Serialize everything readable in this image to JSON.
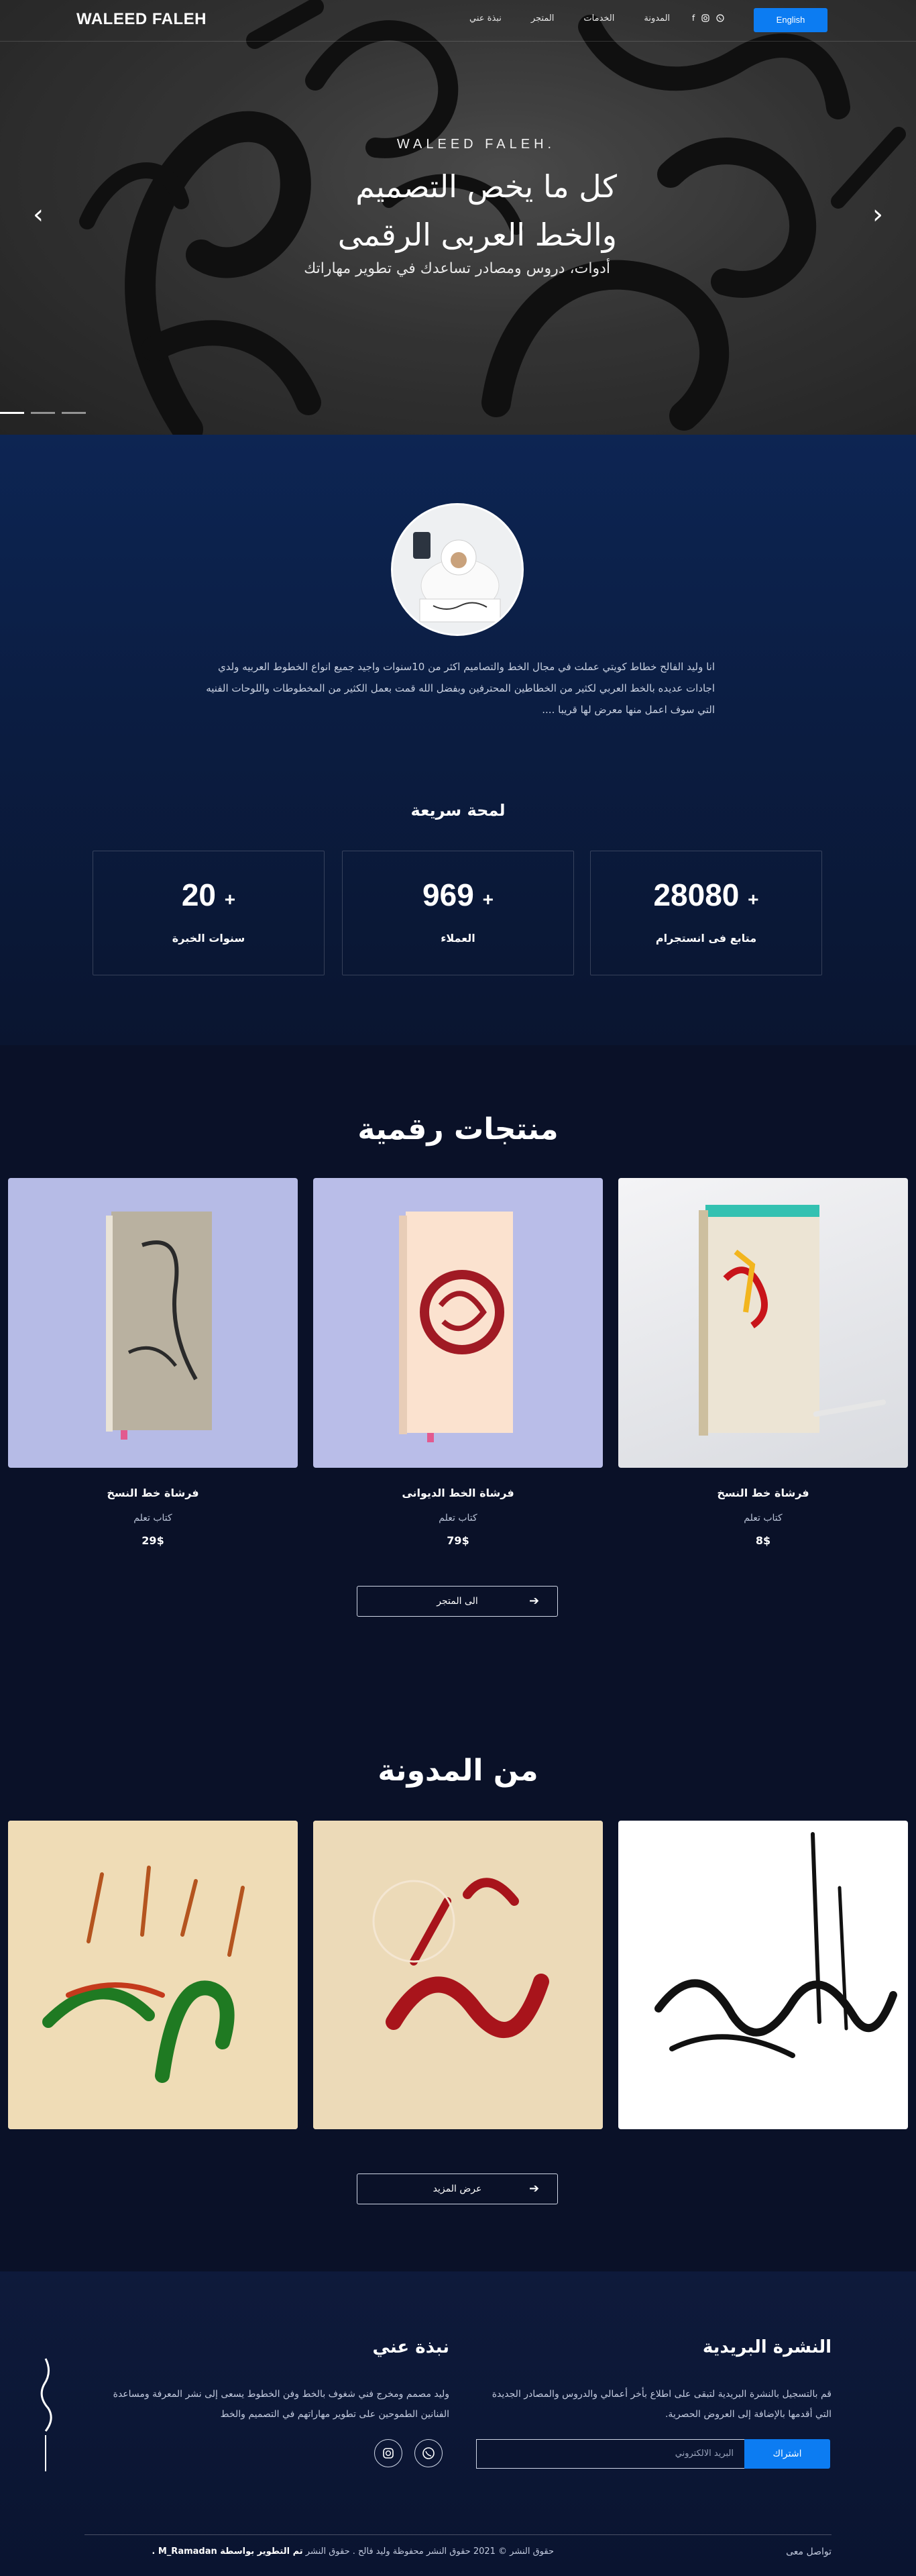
{
  "nav": {
    "brand": "WALEED FALEH",
    "links": [
      "المدونة",
      "الخدمات",
      "المتجر",
      "نبذة عني"
    ],
    "social_icons": [
      "whatsapp-icon",
      "instagram-icon",
      "facebook-icon"
    ],
    "lang_button": "English"
  },
  "hero": {
    "kicker": "WALEED FALEH.",
    "title_line1": "كل ما يخص التصميم",
    "title_line2": "والخط العربى الرقمى",
    "subtitle": "أدوات، دروس ومصادر تساعدك في تطوير مهاراتك",
    "slide_count": 3,
    "active_slide": 1
  },
  "about": {
    "text": "انا وليد الفالح خطاط كويتي عملت في مجال الخط والتصاميم اكثر من 10سنوات واجيد جميع انواع الخطوط العربيه ولدي اجادات عديده بالخط العربي لكثير من الخطاطين المحترفين وبفضل الله قمت بعمل الكثير من المخطوطات واللوحات الفنيه التي سوف اعمل منها معرض لها قريبا ...."
  },
  "stats": {
    "title": "لمحة سريعة",
    "items": [
      {
        "value": "28080",
        "plus": "+",
        "label": "متابع فى انستجرام"
      },
      {
        "value": "969",
        "plus": "+",
        "label": "العملاء"
      },
      {
        "value": "20",
        "plus": "+",
        "label": "سنوات الخبرة"
      }
    ]
  },
  "products": {
    "title": "منتجات رقمية",
    "items": [
      {
        "name": "فرشاة خط النسخ",
        "category": "كتاب تعلم",
        "price": "8$"
      },
      {
        "name": "فرشاة الخط الديوانى",
        "category": "كتاب تعلم",
        "price": "79$"
      },
      {
        "name": "فرشاة خط النسخ",
        "category": "كتاب تعلم",
        "price": "29$"
      }
    ],
    "button": "الى المتجر"
  },
  "blog": {
    "title": "من المدونة",
    "button": "عرض المزيد"
  },
  "footer": {
    "newsletter_title": "النشرة البريدية",
    "newsletter_text": "قم بالتسجيل بالنشرة البريدية لتبقى على اطلاع بأخر أعمالي والدروس والمصادر الجديدة التي أقدمها بالإضافة إلى العروض الحصرية.",
    "email_placeholder": "البريد الالكتروني",
    "subscribe_button": "اشتراك",
    "about_title": "نبذة عني",
    "about_text": "وليد مصمم ومخرج فني شغوف بالخط وفن الخطوط يسعى إلى نشر المعرفة ومساعدة الفنانين الطموحين على تطوير مهاراتهم في التصميم والخط",
    "social_icons": [
      "whatsapp-icon",
      "instagram-icon"
    ],
    "copyright_prefix": "حقوق النشر © 2021 حقوق النشر محفوظة وليد فالح . حقوق النشر",
    "developer": "تم التطوير بواسطة M_Ramadan .",
    "contact": "تواصل معى",
    "signature": "وليد الفالح"
  }
}
